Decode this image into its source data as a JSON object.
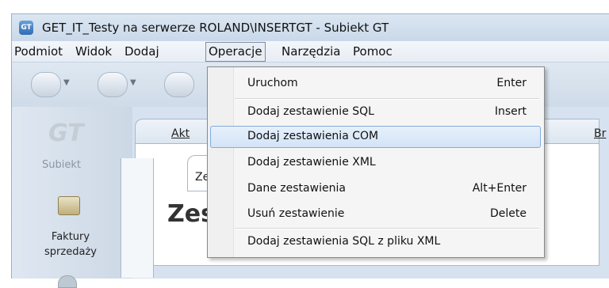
{
  "window": {
    "title": "GET_IT_Testy na serwerze ROLAND\\INSERTGT - Subiekt GT",
    "app_icon": "subiekt-gt-icon"
  },
  "menubar": {
    "items": [
      {
        "label": "Podmiot"
      },
      {
        "label": "Widok"
      },
      {
        "label": "Dodaj"
      },
      {
        "label": "Operacje"
      },
      {
        "label": "Narzędzia"
      },
      {
        "label": "Pomoc"
      }
    ]
  },
  "dropdown": {
    "items": [
      {
        "label": "Uruchom",
        "shortcut": "Enter"
      },
      {
        "label": "Dodaj zestawienie SQL",
        "shortcut": "Insert"
      },
      {
        "label": "Dodaj zestawienia COM",
        "shortcut": ""
      },
      {
        "label": "Dodaj zestawienie XML",
        "shortcut": ""
      },
      {
        "label": "Dane zestawienia",
        "shortcut": "Alt+Enter"
      },
      {
        "label": "Usuń zestawienie",
        "shortcut": "Delete"
      },
      {
        "label": "Dodaj zestawienia SQL z pliku XML",
        "shortcut": ""
      }
    ],
    "highlighted_index": 2,
    "highlight_color": "#d3e4f7"
  },
  "sidebar": {
    "logo_text": "GT",
    "brand_label": "Subiekt",
    "item_label_line1": "Faktury",
    "item_label_line2": "sprzedaży"
  },
  "main": {
    "tab_left": "Akt",
    "tab_right": "Br",
    "inner_tab": "Ze",
    "heading": "Zes"
  },
  "colors": {
    "title_bar": "#c9d8e9",
    "menu_open_border": "#7c8ca0",
    "highlight_border": "#84acdd"
  }
}
